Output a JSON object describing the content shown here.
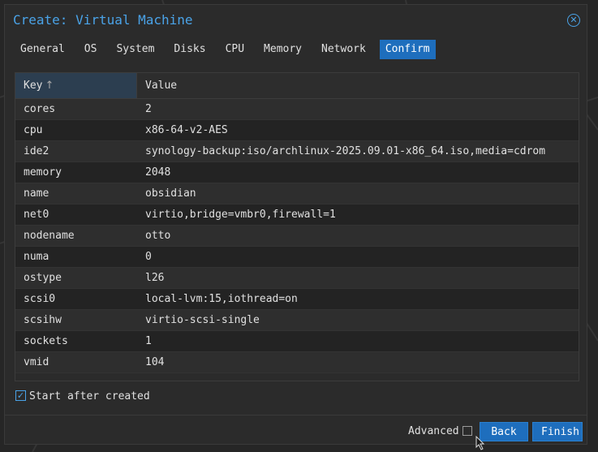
{
  "window": {
    "title": "Create: Virtual Machine"
  },
  "tabs": [
    {
      "label": "General"
    },
    {
      "label": "OS"
    },
    {
      "label": "System"
    },
    {
      "label": "Disks"
    },
    {
      "label": "CPU"
    },
    {
      "label": "Memory"
    },
    {
      "label": "Network"
    },
    {
      "label": "Confirm",
      "active": true
    }
  ],
  "grid": {
    "columns": {
      "key": "Key",
      "value": "Value"
    },
    "rows": [
      {
        "key": "cores",
        "value": "2"
      },
      {
        "key": "cpu",
        "value": "x86-64-v2-AES"
      },
      {
        "key": "ide2",
        "value": "synology-backup:iso/archlinux-2025.09.01-x86_64.iso,media=cdrom"
      },
      {
        "key": "memory",
        "value": "2048"
      },
      {
        "key": "name",
        "value": "obsidian"
      },
      {
        "key": "net0",
        "value": "virtio,bridge=vmbr0,firewall=1"
      },
      {
        "key": "nodename",
        "value": "otto"
      },
      {
        "key": "numa",
        "value": "0"
      },
      {
        "key": "ostype",
        "value": "l26"
      },
      {
        "key": "scsi0",
        "value": "local-lvm:15,iothread=on"
      },
      {
        "key": "scsihw",
        "value": "virtio-scsi-single"
      },
      {
        "key": "sockets",
        "value": "1"
      },
      {
        "key": "vmid",
        "value": "104"
      }
    ]
  },
  "start_after_created": {
    "label": "Start after created",
    "checked": true
  },
  "footer": {
    "advanced_label": "Advanced",
    "back_label": "Back",
    "finish_label": "Finish"
  },
  "colors": {
    "accent": "#4aa3e8",
    "button": "#1e6ebd",
    "background": "#2b2b2b"
  }
}
